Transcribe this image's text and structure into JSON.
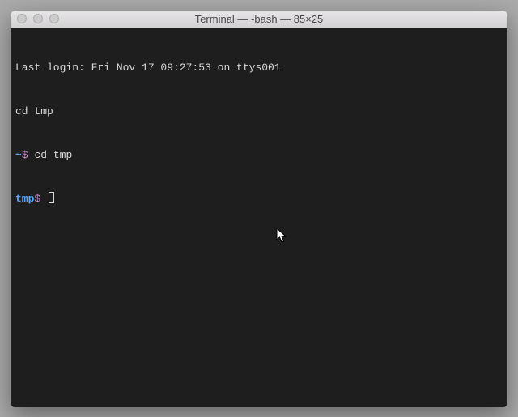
{
  "window": {
    "title": "Terminal — -bash — 85×25"
  },
  "terminal": {
    "last_login": "Last login: Fri Nov 17 09:27:53 on ttys001",
    "echoed_command": "cd tmp",
    "line1": {
      "path": "~",
      "symbol": "$",
      "command": "cd tmp"
    },
    "line2": {
      "path": "tmp",
      "symbol": "$"
    }
  },
  "colors": {
    "bg": "#1e1e1e",
    "text": "#d8d8d8",
    "path": "#58a6ff",
    "symbol": "#c586c0"
  }
}
